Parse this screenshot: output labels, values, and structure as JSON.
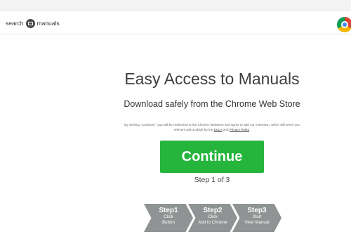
{
  "header": {
    "logo_left": "search",
    "logo_right": "manuals",
    "logo_icon": "manual-icon",
    "browser_icon": "chrome-icon"
  },
  "main": {
    "headline": "Easy Access to Manuals",
    "subheadline": "Download safely from the Chrome Web Store",
    "disclaimer": {
      "text_before": "By clicking \"Continue\", you will be redirected to the Chrome Webstore and agree to add our extension, which will serve you relevant ads & abide by the ",
      "eula_link": "EULA",
      "text_middle": " and ",
      "privacy_link": "Privacy Policy",
      "text_after": "."
    },
    "continue_label": "Continue",
    "step_counter": "Step 1 of 3"
  },
  "steps": [
    {
      "title": "Step1",
      "line1": "Click",
      "line2": "Button"
    },
    {
      "title": "Step2",
      "line1": "Click",
      "line2": "Add to Chrome"
    },
    {
      "title": "Step3",
      "line1": "Start",
      "line2": "View Manual"
    }
  ],
  "colors": {
    "continue_button": "#25b43c",
    "step_arrows": "#8f9393"
  }
}
